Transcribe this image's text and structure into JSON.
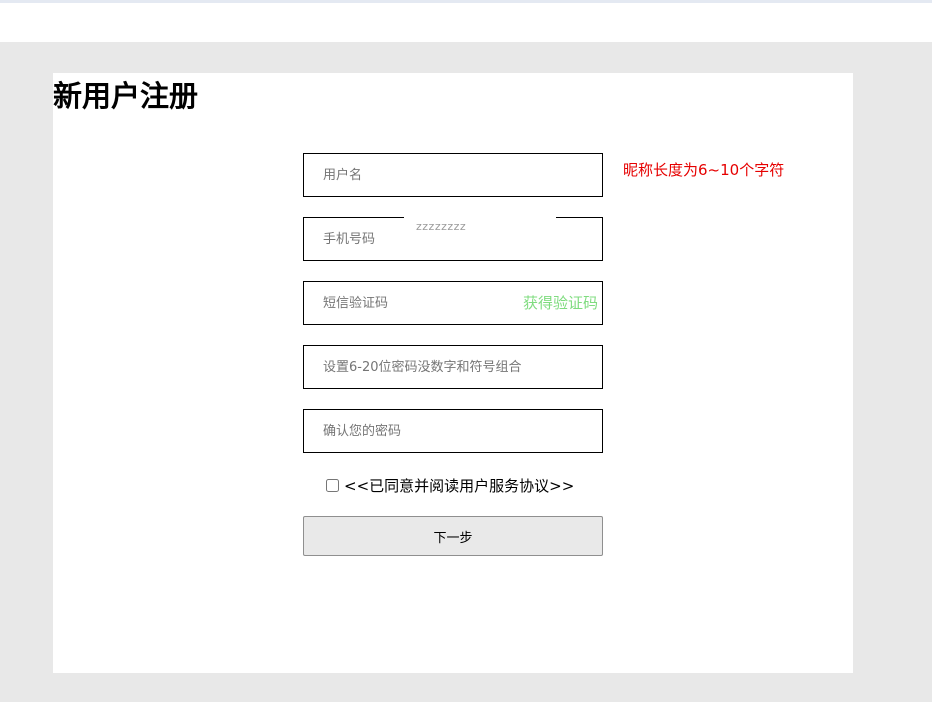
{
  "page": {
    "title": "新用户注册"
  },
  "form": {
    "username": {
      "placeholder": "用户名",
      "hint": "昵称长度为6~10个字符"
    },
    "phone": {
      "placeholder": "手机号码",
      "tooltip": "zzzzzzzz"
    },
    "sms_code": {
      "placeholder": "短信验证码",
      "get_code_label": "获得验证码"
    },
    "password": {
      "placeholder": "设置6-20位密码没数字和符号组合"
    },
    "confirm_password": {
      "placeholder": "确认您的密码"
    },
    "agreement": {
      "label": "<<已同意并阅读用户服务协议>>",
      "checked": false
    },
    "next_label": "下一步"
  },
  "colors": {
    "hint": "#e60000",
    "get_code": "#7fdc7f",
    "page_background": "#e8e8e8"
  }
}
